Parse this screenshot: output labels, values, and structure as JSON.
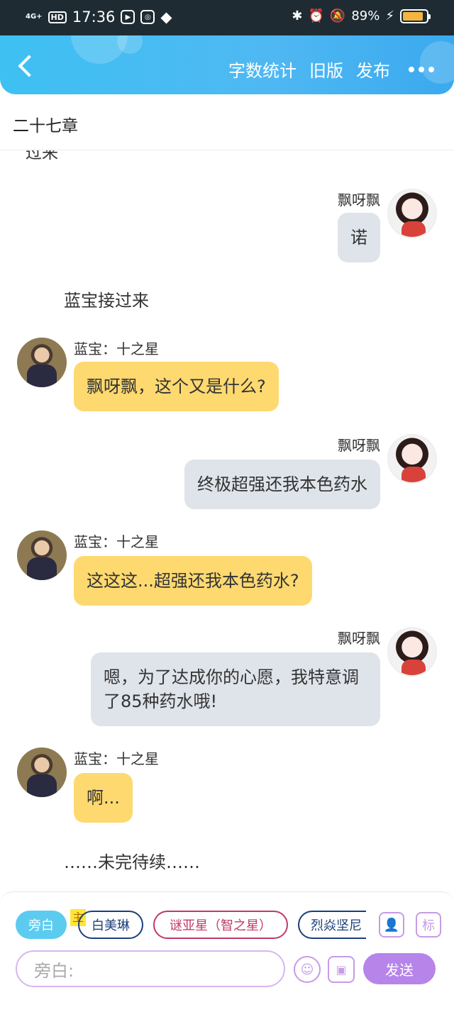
{
  "status_bar": {
    "network": "4G+",
    "hd": "HD",
    "time": "17:36",
    "battery": "89%",
    "battery_level": 0.89
  },
  "header": {
    "word_count": "字数统计",
    "old_version": "旧版",
    "publish": "发布"
  },
  "chapter": {
    "title": "二十七章"
  },
  "content": {
    "cut_text": "过来",
    "narration_1": "蓝宝接过来",
    "end_text": "……未完待续……",
    "messages": [
      {
        "speaker": "飘呀飘",
        "text": "诺",
        "side": "right"
      },
      {
        "speaker": "蓝宝：十之星",
        "text": "飘呀飘，这个又是什么?",
        "side": "left"
      },
      {
        "speaker": "飘呀飘",
        "text": "终极超强还我本色药水",
        "side": "right"
      },
      {
        "speaker": "蓝宝：十之星",
        "text": "这这这...超强还我本色药水?",
        "side": "left"
      },
      {
        "speaker": "飘呀飘",
        "text": "嗯，为了达成你的心愿，我特意调了85种药水哦!",
        "side": "right"
      },
      {
        "speaker": "蓝宝：十之星",
        "text": "啊...",
        "side": "left"
      }
    ]
  },
  "bottom": {
    "roles": [
      "旁白",
      "白美琳",
      "谜亚星（智之星）",
      "烈焱坚尼"
    ],
    "main_tag": "主",
    "tag_icon_label": "标",
    "input_placeholder": "旁白:",
    "send": "发送"
  }
}
